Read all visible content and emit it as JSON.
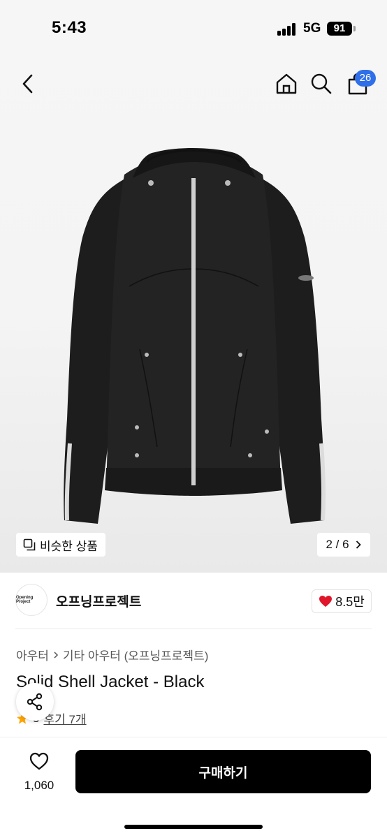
{
  "status_bar": {
    "time": "5:43",
    "network": "5G",
    "battery": "91"
  },
  "nav": {
    "back_icon": "chevron-left-icon",
    "home_icon": "home-icon",
    "search_icon": "search-icon",
    "cart_icon": "shopping-bag-icon",
    "cart_count": "26"
  },
  "gallery": {
    "similar_label": "비슷한 상품",
    "page_indicator": "2 / 6"
  },
  "brand": {
    "logo_text": "Opening Project",
    "name": "오프닝프로젝트",
    "likes": "8.5만"
  },
  "product": {
    "category_parent": "아우터",
    "category_child": "기타 아우터 (오프닝프로젝트)",
    "title": "Solid Shell Jacket - Black",
    "rating": "5",
    "reviews": "후기 7개"
  },
  "bottom_bar": {
    "wish_count": "1,060",
    "buy_label": "구매하기"
  },
  "colors": {
    "accent": "#2f6fe8",
    "like_heart": "#e0162b",
    "star": "#ffa400",
    "buy_button": "#000000"
  }
}
